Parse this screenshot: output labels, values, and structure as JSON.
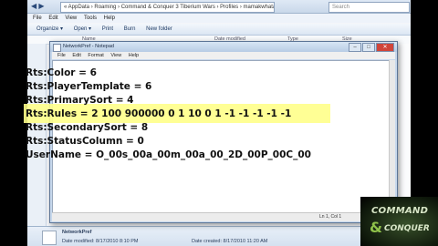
{
  "explorer": {
    "address": "« AppData › Roaming › Command & Conquer 3 Tiberium Wars › Profiles › mamakwhatajis",
    "search_placeholder": "Search",
    "menu": [
      "File",
      "Edit",
      "View",
      "Tools",
      "Help"
    ],
    "commands": [
      "Organize ▾",
      "Open ▾",
      "Print",
      "Burn",
      "New folder"
    ],
    "columns": [
      "Name",
      "Date modified",
      "Type",
      "Size"
    ],
    "details": {
      "name": "NetworkPref",
      "modified": "Date modified: 8/17/2010 8:10 PM",
      "created": "Date created: 8/17/2010 11:20 AM"
    }
  },
  "notepad": {
    "title": "NetworkPref - Notepad",
    "menu": [
      "File",
      "Edit",
      "Format",
      "View",
      "Help"
    ],
    "status": "Ln 1, Col 1",
    "lines": [
      "Rts:Color = 6",
      "Rts:PlayerTemplate = 6",
      "Rts:PrimarySort = 4",
      "Rts:Rules = 2 100 900000 0 1 10 0 1 -1 -1 -1 -1 -1",
      "Rts:SecondarySort = 8",
      "Rts:StatusColumn = 0",
      "UserName = O_00s_00a_00m_00a_00_2D_00P_00C_00"
    ],
    "highlight_color": "#ffff8a"
  },
  "logo": {
    "line1": "COMMAND",
    "line2": "CONQUER",
    "amp": "&"
  }
}
